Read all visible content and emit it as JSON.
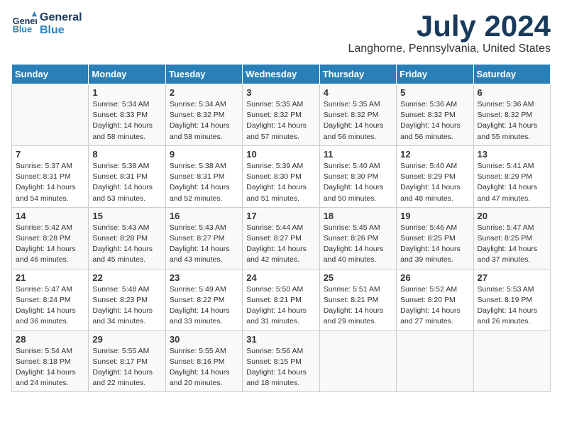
{
  "header": {
    "logo_line1": "General",
    "logo_line2": "Blue",
    "month_year": "July 2024",
    "location": "Langhorne, Pennsylvania, United States"
  },
  "weekdays": [
    "Sunday",
    "Monday",
    "Tuesday",
    "Wednesday",
    "Thursday",
    "Friday",
    "Saturday"
  ],
  "weeks": [
    [
      {
        "day": "",
        "info": ""
      },
      {
        "day": "1",
        "info": "Sunrise: 5:34 AM\nSunset: 8:33 PM\nDaylight: 14 hours\nand 58 minutes."
      },
      {
        "day": "2",
        "info": "Sunrise: 5:34 AM\nSunset: 8:32 PM\nDaylight: 14 hours\nand 58 minutes."
      },
      {
        "day": "3",
        "info": "Sunrise: 5:35 AM\nSunset: 8:32 PM\nDaylight: 14 hours\nand 57 minutes."
      },
      {
        "day": "4",
        "info": "Sunrise: 5:35 AM\nSunset: 8:32 PM\nDaylight: 14 hours\nand 56 minutes."
      },
      {
        "day": "5",
        "info": "Sunrise: 5:36 AM\nSunset: 8:32 PM\nDaylight: 14 hours\nand 56 minutes."
      },
      {
        "day": "6",
        "info": "Sunrise: 5:36 AM\nSunset: 8:32 PM\nDaylight: 14 hours\nand 55 minutes."
      }
    ],
    [
      {
        "day": "7",
        "info": "Sunrise: 5:37 AM\nSunset: 8:31 PM\nDaylight: 14 hours\nand 54 minutes."
      },
      {
        "day": "8",
        "info": "Sunrise: 5:38 AM\nSunset: 8:31 PM\nDaylight: 14 hours\nand 53 minutes."
      },
      {
        "day": "9",
        "info": "Sunrise: 5:38 AM\nSunset: 8:31 PM\nDaylight: 14 hours\nand 52 minutes."
      },
      {
        "day": "10",
        "info": "Sunrise: 5:39 AM\nSunset: 8:30 PM\nDaylight: 14 hours\nand 51 minutes."
      },
      {
        "day": "11",
        "info": "Sunrise: 5:40 AM\nSunset: 8:30 PM\nDaylight: 14 hours\nand 50 minutes."
      },
      {
        "day": "12",
        "info": "Sunrise: 5:40 AM\nSunset: 8:29 PM\nDaylight: 14 hours\nand 48 minutes."
      },
      {
        "day": "13",
        "info": "Sunrise: 5:41 AM\nSunset: 8:29 PM\nDaylight: 14 hours\nand 47 minutes."
      }
    ],
    [
      {
        "day": "14",
        "info": "Sunrise: 5:42 AM\nSunset: 8:28 PM\nDaylight: 14 hours\nand 46 minutes."
      },
      {
        "day": "15",
        "info": "Sunrise: 5:43 AM\nSunset: 8:28 PM\nDaylight: 14 hours\nand 45 minutes."
      },
      {
        "day": "16",
        "info": "Sunrise: 5:43 AM\nSunset: 8:27 PM\nDaylight: 14 hours\nand 43 minutes."
      },
      {
        "day": "17",
        "info": "Sunrise: 5:44 AM\nSunset: 8:27 PM\nDaylight: 14 hours\nand 42 minutes."
      },
      {
        "day": "18",
        "info": "Sunrise: 5:45 AM\nSunset: 8:26 PM\nDaylight: 14 hours\nand 40 minutes."
      },
      {
        "day": "19",
        "info": "Sunrise: 5:46 AM\nSunset: 8:25 PM\nDaylight: 14 hours\nand 39 minutes."
      },
      {
        "day": "20",
        "info": "Sunrise: 5:47 AM\nSunset: 8:25 PM\nDaylight: 14 hours\nand 37 minutes."
      }
    ],
    [
      {
        "day": "21",
        "info": "Sunrise: 5:47 AM\nSunset: 8:24 PM\nDaylight: 14 hours\nand 36 minutes."
      },
      {
        "day": "22",
        "info": "Sunrise: 5:48 AM\nSunset: 8:23 PM\nDaylight: 14 hours\nand 34 minutes."
      },
      {
        "day": "23",
        "info": "Sunrise: 5:49 AM\nSunset: 8:22 PM\nDaylight: 14 hours\nand 33 minutes."
      },
      {
        "day": "24",
        "info": "Sunrise: 5:50 AM\nSunset: 8:21 PM\nDaylight: 14 hours\nand 31 minutes."
      },
      {
        "day": "25",
        "info": "Sunrise: 5:51 AM\nSunset: 8:21 PM\nDaylight: 14 hours\nand 29 minutes."
      },
      {
        "day": "26",
        "info": "Sunrise: 5:52 AM\nSunset: 8:20 PM\nDaylight: 14 hours\nand 27 minutes."
      },
      {
        "day": "27",
        "info": "Sunrise: 5:53 AM\nSunset: 8:19 PM\nDaylight: 14 hours\nand 26 minutes."
      }
    ],
    [
      {
        "day": "28",
        "info": "Sunrise: 5:54 AM\nSunset: 8:18 PM\nDaylight: 14 hours\nand 24 minutes."
      },
      {
        "day": "29",
        "info": "Sunrise: 5:55 AM\nSunset: 8:17 PM\nDaylight: 14 hours\nand 22 minutes."
      },
      {
        "day": "30",
        "info": "Sunrise: 5:55 AM\nSunset: 8:16 PM\nDaylight: 14 hours\nand 20 minutes."
      },
      {
        "day": "31",
        "info": "Sunrise: 5:56 AM\nSunset: 8:15 PM\nDaylight: 14 hours\nand 18 minutes."
      },
      {
        "day": "",
        "info": ""
      },
      {
        "day": "",
        "info": ""
      },
      {
        "day": "",
        "info": ""
      }
    ]
  ]
}
